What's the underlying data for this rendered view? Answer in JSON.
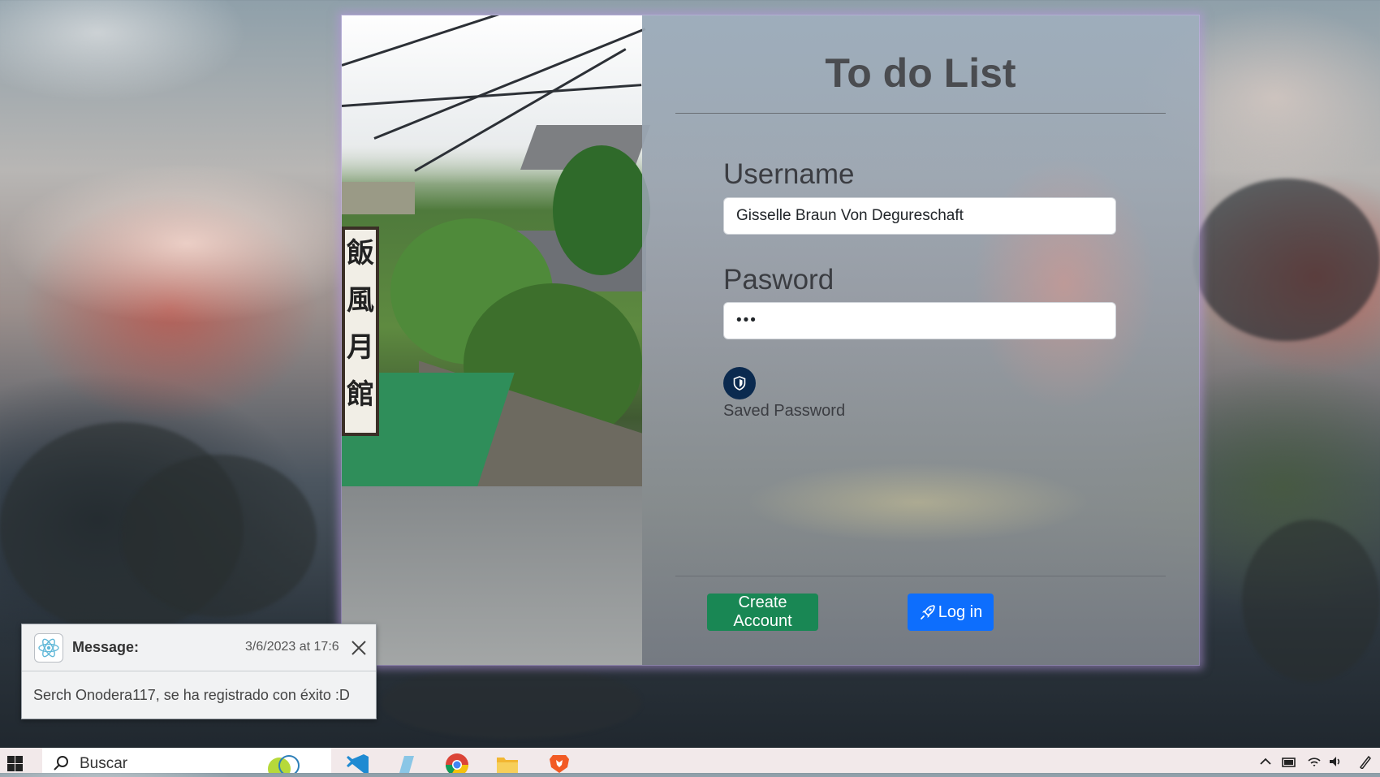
{
  "app": {
    "title": "To do List",
    "username_label": "Username",
    "username_value": "Gisselle Braun Von Degureschaft",
    "password_label": "Pasword",
    "password_value": "•••",
    "saved_password_label": "Saved Password",
    "create_account_label": "Create Account",
    "login_label": "Log in",
    "login_icon": "rocket-icon",
    "saved_password_icon": "shield-icon"
  },
  "photo": {
    "sign_text": [
      "飯",
      "風",
      "月",
      "館"
    ]
  },
  "notification": {
    "title": "Message:",
    "timestamp": "3/6/2023 at 17:6",
    "body": "Serch Onodera117, se ha registrado con éxito :D",
    "icon": "react-icon"
  },
  "taskbar": {
    "search_placeholder": "Buscar",
    "apps": [
      "windows-start-icon",
      "search-icon",
      "widget-icon",
      "vscode-icon",
      "edit-icon",
      "chrome-icon",
      "file-explorer-icon",
      "brave-icon"
    ],
    "tray": [
      "chevron-up-icon",
      "battery-icon",
      "wifi-icon",
      "volume-icon",
      "pen-icon"
    ]
  },
  "colors": {
    "create_button": "#198754",
    "login_button": "#0d6efd",
    "shield_button": "#0b2a4f",
    "window_glow": "#b496dc"
  }
}
